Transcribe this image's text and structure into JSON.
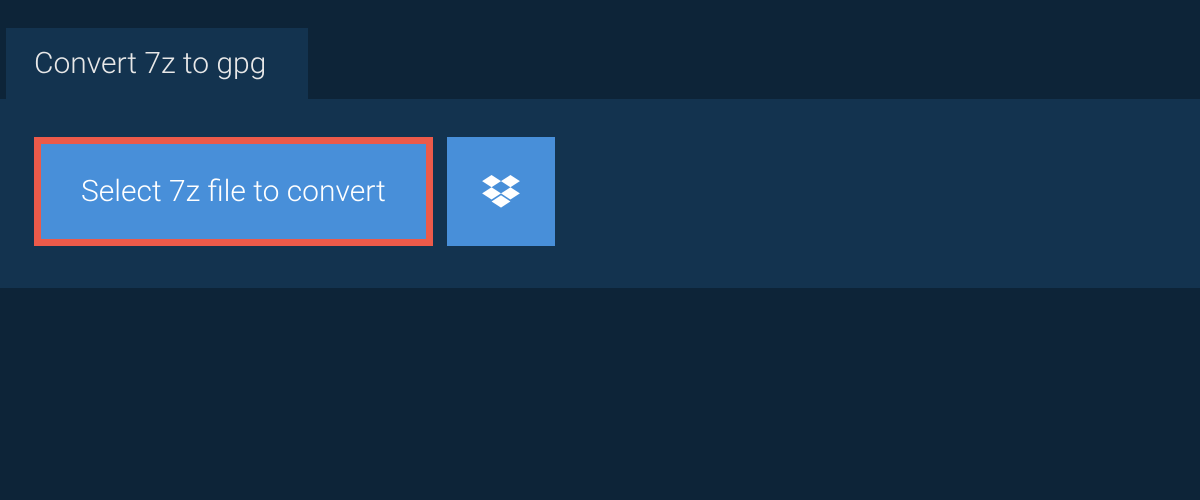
{
  "tab": {
    "title": "Convert 7z to gpg"
  },
  "actions": {
    "select_file_label": "Select 7z file to convert"
  },
  "colors": {
    "page_bg": "#0d2438",
    "panel_bg": "#13334f",
    "button_bg": "#488fd9",
    "highlight_border": "#ec5a4a",
    "text_light": "#ffffff"
  }
}
